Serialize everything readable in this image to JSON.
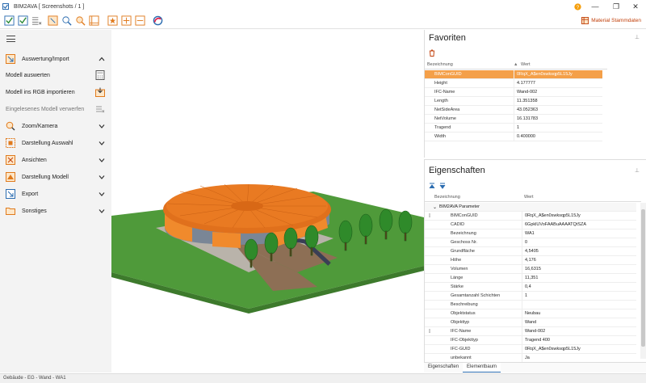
{
  "titlebar": {
    "title": "BIM2AVA [ Screenshots /  1 ]",
    "help_icon": "help-circle-icon",
    "minimize": "—",
    "restore": "❐",
    "close": "✕"
  },
  "toolbar": {
    "stammdaten_label": "Material Stammdaten"
  },
  "sidebar": {
    "items": [
      {
        "label": "Auswertung/Import",
        "icon": "import-icon",
        "chevron": "up"
      },
      {
        "label": "Modell auswerten",
        "right_icon": "calculator-icon"
      },
      {
        "label": "Modell ins RGB importieren",
        "right_icon": "import-rgb-icon"
      },
      {
        "label": "Eingelesenes Modell verwerfen",
        "right_icon": "discard-icon"
      },
      {
        "label": "Zoom/Kamera",
        "icon": "zoom-icon",
        "chevron": "down"
      },
      {
        "label": "Darstellung Auswahl",
        "icon": "selection-icon",
        "chevron": "down"
      },
      {
        "label": "Ansichten",
        "icon": "views-icon",
        "chevron": "down"
      },
      {
        "label": "Darstellung Modell",
        "icon": "model-display-icon",
        "chevron": "down"
      },
      {
        "label": "Export",
        "icon": "export-icon",
        "chevron": "down"
      },
      {
        "label": "Sonstiges",
        "icon": "folder-icon",
        "chevron": "down"
      }
    ]
  },
  "favoriten": {
    "title": "Favoriten",
    "col_name": "Bezeichnung",
    "col_value": "Wert",
    "rows": [
      {
        "name": "BIMConGUID",
        "value": "0RqX_A$en0swksqp5L15Jy",
        "selected": true
      },
      {
        "name": "Height",
        "value": "4.177777"
      },
      {
        "name": "IFC-Name",
        "value": "Wand-002"
      },
      {
        "name": "Length",
        "value": "11.351358"
      },
      {
        "name": "NetSideArea",
        "value": "43.052363"
      },
      {
        "name": "NetVolume",
        "value": "16.131783"
      },
      {
        "name": "Tragend",
        "value": "1"
      },
      {
        "name": "Width",
        "value": "0.400000"
      }
    ]
  },
  "eigenschaften": {
    "title": "Eigenschaften",
    "col_name": "Bezeichnung",
    "col_value": "Wert",
    "group": "BIM2AVA Parameter",
    "rows": [
      {
        "name": "BIMConGUID",
        "value": "0RqX_A$en0swksqp5L15Jy",
        "bookmark": true
      },
      {
        "name": "CADID",
        "value": "6GpklUVoFAABuAAAATQtSZA"
      },
      {
        "name": "Bezeichnung",
        "value": "WA1"
      },
      {
        "name": "Geschoss Nr.",
        "value": "0"
      },
      {
        "name": "Grundfläche",
        "value": "4,5405"
      },
      {
        "name": "Höhe",
        "value": "4,176"
      },
      {
        "name": "Volumen",
        "value": "16,6315"
      },
      {
        "name": "Länge",
        "value": "11,351"
      },
      {
        "name": "Stärke",
        "value": "0,4"
      },
      {
        "name": "Gesamtanzahl Schichten",
        "value": "1"
      },
      {
        "name": "Beschreibung",
        "value": ""
      },
      {
        "name": "Objektstatus",
        "value": "Neubau"
      },
      {
        "name": "Objekttyp",
        "value": "Wand"
      },
      {
        "name": "IFC-Name",
        "value": "Wand-002",
        "bookmark": true
      },
      {
        "name": "IFC-Objekttyp",
        "value": "Tragend 400"
      },
      {
        "name": "IFC-GUID",
        "value": "0RqX_A$en0swksqp5L15Jy"
      },
      {
        "name": "unbekannt",
        "value": "Ja"
      }
    ],
    "tabs": [
      "Eigenschaften",
      "Elementbaum"
    ]
  },
  "statusbar": {
    "text": "Gebäude - EG - Wand - WA1"
  },
  "colors": {
    "accent": "#f4a049",
    "roof": "#e0701c",
    "grass": "#4f9a3a",
    "tree": "#2f8a2a"
  }
}
